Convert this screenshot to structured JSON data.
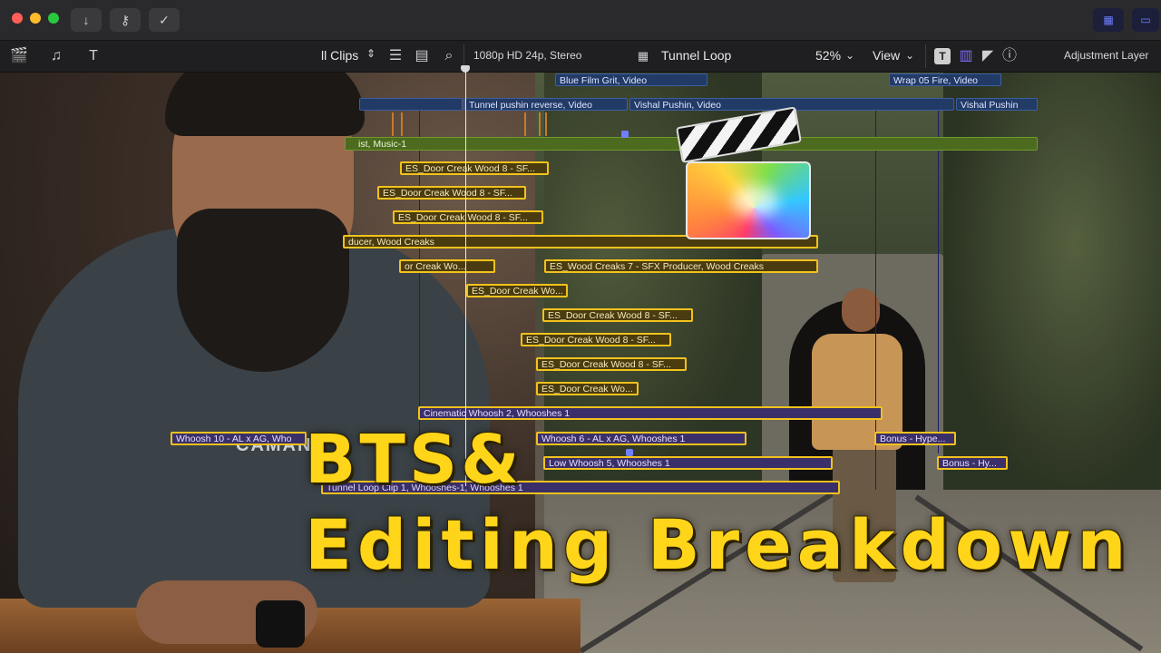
{
  "window": {
    "traffic_lights": {
      "close": "#ff5f57",
      "minimize": "#febc2e",
      "zoom": "#28c840"
    },
    "toolbar_icons": [
      "import-icon",
      "keyword-icon",
      "background-tasks-icon"
    ],
    "right_icons": [
      "grid-view-icon",
      "film-strip-view-icon"
    ]
  },
  "browser_bar": {
    "clips_label": "ll Clips",
    "format": "1080p HD 24p, Stereo",
    "project_name": "Tunnel Loop",
    "zoom": "52%",
    "view_label": "View",
    "inspector_label": "Adjustment Layer"
  },
  "timeline": {
    "video_clips": [
      {
        "label": "Blue Film Grit, Video"
      },
      {
        "label": "Wrap 05 Fire, Video"
      },
      {
        "label": ""
      },
      {
        "label": "Tunnel pushin reverse, Video"
      },
      {
        "label": "Vishal Pushin, Video"
      },
      {
        "label": "Vishal Pushin"
      }
    ],
    "music_clip": "ist, Music-1",
    "audio_clips": [
      "ES_Door Creak Wood 8 - SF...",
      "ES_Door Creak Wood 8 - SF...",
      "ES_Door Creak Wood 8 - SF...",
      "ducer, Wood Creaks",
      "or Creak Wo...",
      "ES_Wood Creaks 7 - SFX Producer, Wood Creaks",
      "ES_Door Creak Wo...",
      "ES_Door Creak Wood 8 - SF...",
      "ES_Door Creak Wood 8 - SF...",
      "ES_Door Creak Wood 8 - SF...",
      "ES_Door Creak Wo..."
    ],
    "whoosh_clips": [
      "Cinematic Whoosh 2, Whooshes 1",
      "Whoosh 10 - AL x AG, Who",
      "Whoosh 6 - AL x AG, Whooshes 1",
      "Bonus - Hype...",
      "Low Whoosh 5, Whooshes 1",
      "Bonus - Hy...",
      "Tunnel Loop Clip 1, Whooshes-1, Whooshes 1"
    ]
  },
  "overlay": {
    "line1": "BTS&",
    "line2": "Editing Breakdown",
    "color": "#ffd51a"
  },
  "logo": {
    "name": "final-cut-pro-logo"
  },
  "hoodie_print": "CAMAN"
}
